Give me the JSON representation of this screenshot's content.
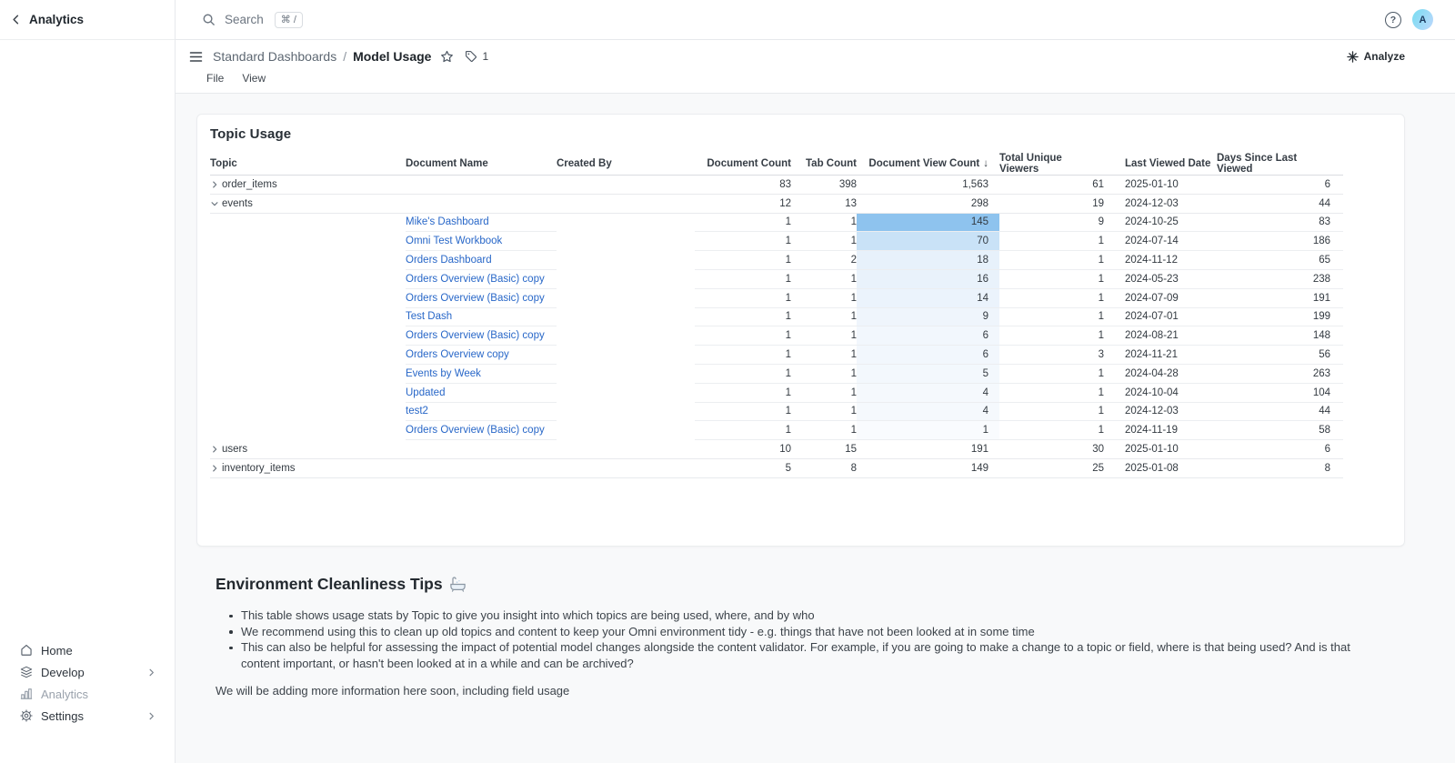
{
  "sidebar": {
    "title": "Analytics",
    "nav": [
      {
        "label": "Home",
        "icon": "home-icon",
        "chevron": false,
        "muted": false
      },
      {
        "label": "Develop",
        "icon": "develop-icon",
        "chevron": true,
        "muted": false
      },
      {
        "label": "Analytics",
        "icon": "analytics-icon",
        "chevron": false,
        "muted": true
      },
      {
        "label": "Settings",
        "icon": "settings-icon",
        "chevron": true,
        "muted": false
      }
    ]
  },
  "topbar": {
    "search_label": "Search",
    "search_shortcut": "⌘ /",
    "help_glyph": "?",
    "avatar_initial": "A"
  },
  "toolbar": {
    "breadcrumb_parent": "Standard Dashboards",
    "breadcrumb_separator": "/",
    "breadcrumb_current": "Model Usage",
    "tag_count": "1",
    "analyze_label": "Analyze",
    "menus": {
      "file": "File",
      "view": "View"
    }
  },
  "table": {
    "title": "Topic Usage",
    "sort_indicator": "↓",
    "columns": [
      {
        "label": "Topic"
      },
      {
        "label": "Document Name"
      },
      {
        "label": "Created By"
      },
      {
        "label": "Document Count"
      },
      {
        "label": "Tab Count"
      },
      {
        "label": "Document View Count",
        "sorted": true
      },
      {
        "label": "Total Unique Viewers"
      },
      {
        "label": "Last Viewed Date"
      },
      {
        "label": "Days Since Last Viewed"
      }
    ],
    "rows": [
      {
        "type": "topic",
        "topic": "order_items",
        "expanded": false,
        "doc_count": "83",
        "tab_count": "398",
        "view_count": "1,563",
        "view_bg": null,
        "viewers": "61",
        "last_viewed": "2025-01-10",
        "days": "6"
      },
      {
        "type": "topic",
        "topic": "events",
        "expanded": true,
        "doc_count": "12",
        "tab_count": "13",
        "view_count": "298",
        "view_bg": null,
        "viewers": "19",
        "last_viewed": "2024-12-03",
        "days": "44"
      },
      {
        "type": "doc",
        "name": "Mike's Dashboard",
        "doc_count": "1",
        "tab_count": "1",
        "view_count": "145",
        "view_bg": "#8ec3ee",
        "viewers": "9",
        "last_viewed": "2024-10-25",
        "days": "83"
      },
      {
        "type": "doc",
        "name": "Omni Test Workbook",
        "doc_count": "1",
        "tab_count": "1",
        "view_count": "70",
        "view_bg": "#c9e2f7",
        "viewers": "1",
        "last_viewed": "2024-07-14",
        "days": "186"
      },
      {
        "type": "doc",
        "name": "Orders Dashboard",
        "doc_count": "1",
        "tab_count": "2",
        "view_count": "18",
        "view_bg": "#e7f1fb",
        "viewers": "1",
        "last_viewed": "2024-11-12",
        "days": "65"
      },
      {
        "type": "doc",
        "name": "Orders Overview (Basic) copy",
        "doc_count": "1",
        "tab_count": "1",
        "view_count": "16",
        "view_bg": "#e9f2fb",
        "viewers": "1",
        "last_viewed": "2024-05-23",
        "days": "238"
      },
      {
        "type": "doc",
        "name": "Orders Overview (Basic) copy",
        "doc_count": "1",
        "tab_count": "1",
        "view_count": "14",
        "view_bg": "#ebf3fc",
        "viewers": "1",
        "last_viewed": "2024-07-09",
        "days": "191"
      },
      {
        "type": "doc",
        "name": "Test Dash",
        "doc_count": "1",
        "tab_count": "1",
        "view_count": "9",
        "view_bg": "#eff5fc",
        "viewers": "1",
        "last_viewed": "2024-07-01",
        "days": "199"
      },
      {
        "type": "doc",
        "name": "Orders Overview (Basic) copy",
        "doc_count": "1",
        "tab_count": "1",
        "view_count": "6",
        "view_bg": "#f2f7fd",
        "viewers": "1",
        "last_viewed": "2024-08-21",
        "days": "148"
      },
      {
        "type": "doc",
        "name": "Orders Overview copy",
        "doc_count": "1",
        "tab_count": "1",
        "view_count": "6",
        "view_bg": "#f2f7fd",
        "viewers": "3",
        "last_viewed": "2024-11-21",
        "days": "56"
      },
      {
        "type": "doc",
        "name": "Events by Week",
        "doc_count": "1",
        "tab_count": "1",
        "view_count": "5",
        "view_bg": "#f3f8fd",
        "viewers": "1",
        "last_viewed": "2024-04-28",
        "days": "263"
      },
      {
        "type": "doc",
        "name": "Updated",
        "doc_count": "1",
        "tab_count": "1",
        "view_count": "4",
        "view_bg": "#f5f9fd",
        "viewers": "1",
        "last_viewed": "2024-10-04",
        "days": "104"
      },
      {
        "type": "doc",
        "name": "test2",
        "doc_count": "1",
        "tab_count": "1",
        "view_count": "4",
        "view_bg": "#f5f9fd",
        "viewers": "1",
        "last_viewed": "2024-12-03",
        "days": "44"
      },
      {
        "type": "doc",
        "name": "Orders Overview (Basic) copy",
        "doc_count": "1",
        "tab_count": "1",
        "view_count": "1",
        "view_bg": "#f9fbfe",
        "viewers": "1",
        "last_viewed": "2024-11-19",
        "days": "58"
      },
      {
        "type": "topic",
        "topic": "users",
        "expanded": false,
        "doc_count": "10",
        "tab_count": "15",
        "view_count": "191",
        "view_bg": null,
        "viewers": "30",
        "last_viewed": "2025-01-10",
        "days": "6"
      },
      {
        "type": "topic",
        "topic": "inventory_items",
        "expanded": false,
        "doc_count": "5",
        "tab_count": "8",
        "view_count": "149",
        "view_bg": null,
        "viewers": "25",
        "last_viewed": "2025-01-08",
        "days": "8"
      }
    ]
  },
  "tips": {
    "heading": "Environment Cleanliness Tips",
    "heading_icon": "bathtub-emoji",
    "bullets": [
      "This table shows usage stats by Topic to give you insight into which topics are being used, where, and by who",
      "We recommend using this to clean up old topics and content to keep your Omni environment tidy - e.g. things that have not been looked at in some time",
      "This can also be helpful for assessing the impact of potential model changes alongside the content validator. For example, if you are going to make a change to a topic or field, where is that being used? And is that content important, or hasn't been looked at in a while and can be archived?"
    ],
    "footer": "We will be adding more information here soon, including field usage"
  },
  "colors": {
    "link_blue": "#2867c8",
    "highlight_strong": "#8ec3ee",
    "highlight_mid": "#c9e2f7",
    "background_gray": "#f8f9fa"
  }
}
